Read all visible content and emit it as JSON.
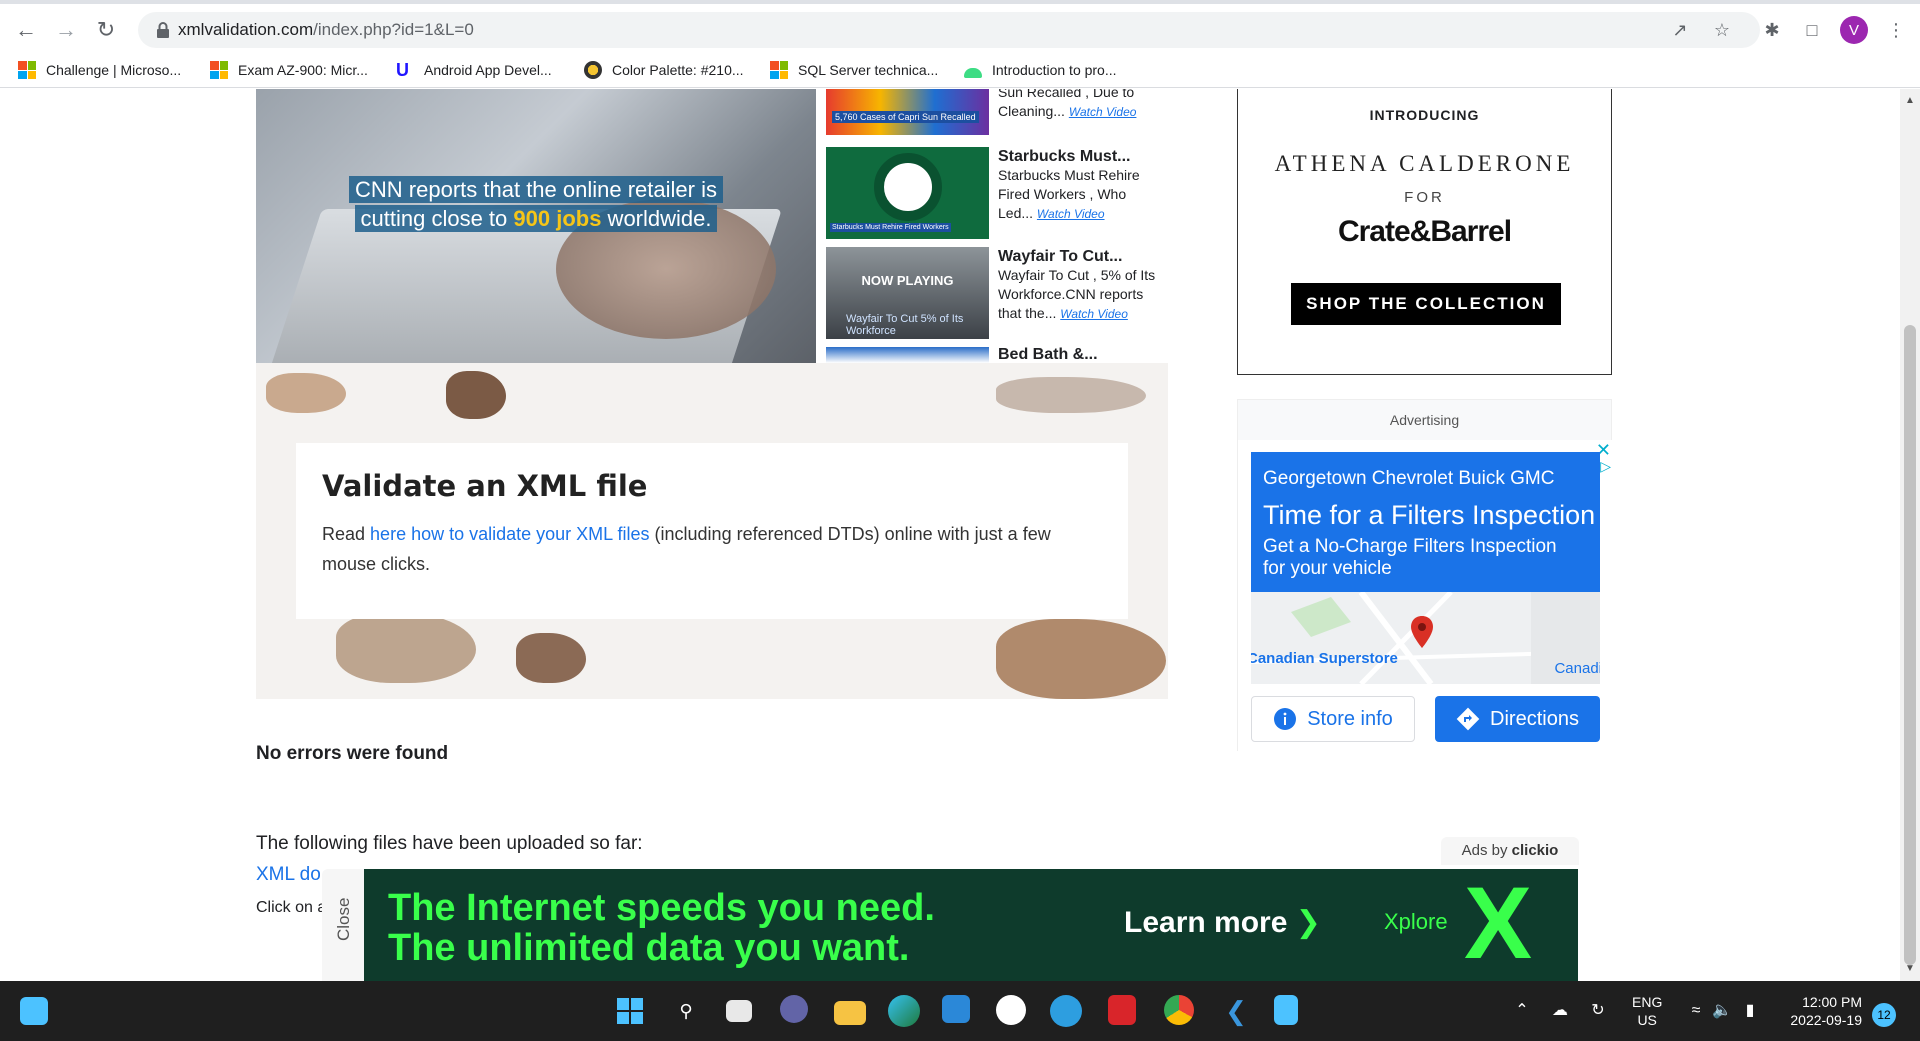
{
  "browser": {
    "url_domain": "xmlvalidation.com",
    "url_path": "/index.php?id=1&L=0",
    "avatar_letter": "V",
    "bookmarks": [
      {
        "label": "Challenge | Microso...",
        "icon": "microsoft-icon"
      },
      {
        "label": "Exam AZ-900: Micr...",
        "icon": "microsoft-icon"
      },
      {
        "label": "Android App Devel...",
        "icon": "udacity-icon"
      },
      {
        "label": "Color Palette: #210...",
        "icon": "palette-icon"
      },
      {
        "label": "SQL Server technica...",
        "icon": "microsoft-icon"
      },
      {
        "label": "Introduction to pro...",
        "icon": "android-icon"
      }
    ]
  },
  "video": {
    "caption_line1": "CNN reports that the online retailer is",
    "caption_line2_pre": "cutting close to ",
    "caption_line2_highlight": "900 jobs",
    "caption_line2_post": " worldwide.",
    "playlist": [
      {
        "title": "",
        "text": "Sun Recalled , Due to Cleaning...",
        "watch": "Watch Video",
        "thumb_text": "5,760 Cases of Capri Sun Recalled"
      },
      {
        "title": "Starbucks Must...",
        "text": "Starbucks Must Rehire Fired Workers , Who Led...",
        "watch": "Watch Video",
        "thumb_text": "Starbucks Must Rehire Fired Workers"
      },
      {
        "title": "Wayfair To Cut...",
        "text": "Wayfair To Cut , 5% of Its Workforce.CNN reports that the...",
        "watch": "Watch Video",
        "thumb_text": "Wayfair To Cut 5% of Its Workforce",
        "now_playing": "NOW PLAYING"
      },
      {
        "title": "Bed Bath &...",
        "text": "",
        "watch": "",
        "thumb_text": ""
      }
    ]
  },
  "hero": {
    "title": "Validate an XML file",
    "text_pre": "Read ",
    "link": "here how to validate your XML files",
    "text_post": " (including referenced DTDs) online with just a few mouse clicks."
  },
  "results": {
    "no_errors": "No errors were found",
    "uploaded": "The following files have been uploaded so far:",
    "xml_link": "XML do",
    "click_on": "Click on a"
  },
  "crate_ad": {
    "introducing": "INTRODUCING",
    "name": "ATHENA CALDERONE",
    "for": "FOR",
    "brand": "Crate&Barrel",
    "button": "SHOP THE COLLECTION"
  },
  "gmc_ad": {
    "advertising": "Advertising",
    "business": "Georgetown Chevrolet Buick GMC",
    "headline": "Time for a Filters Inspection",
    "description": "Get a No-Charge Filters Inspection for your vehicle",
    "map_label1": "Canadian Superstore",
    "map_label2": "Canadi",
    "store_info": "Store info",
    "directions": "Directions"
  },
  "banner": {
    "ads_by_pre": "Ads by ",
    "ads_by_brand": "clickio",
    "close": "Close",
    "line1": "The Internet speeds you need.",
    "line2": "The unlimited data you want.",
    "learn_more": "Learn more",
    "brand": "Xplore",
    "big_letter": "X"
  },
  "taskbar": {
    "lang_line1": "ENG",
    "lang_line2": "US",
    "time": "12:00 PM",
    "date": "2022-09-19",
    "notifications": "12"
  },
  "colors": {
    "link_blue": "#1a73e8",
    "xplore_green": "#39ff4b",
    "banner_bg": "#0e3b2c"
  }
}
